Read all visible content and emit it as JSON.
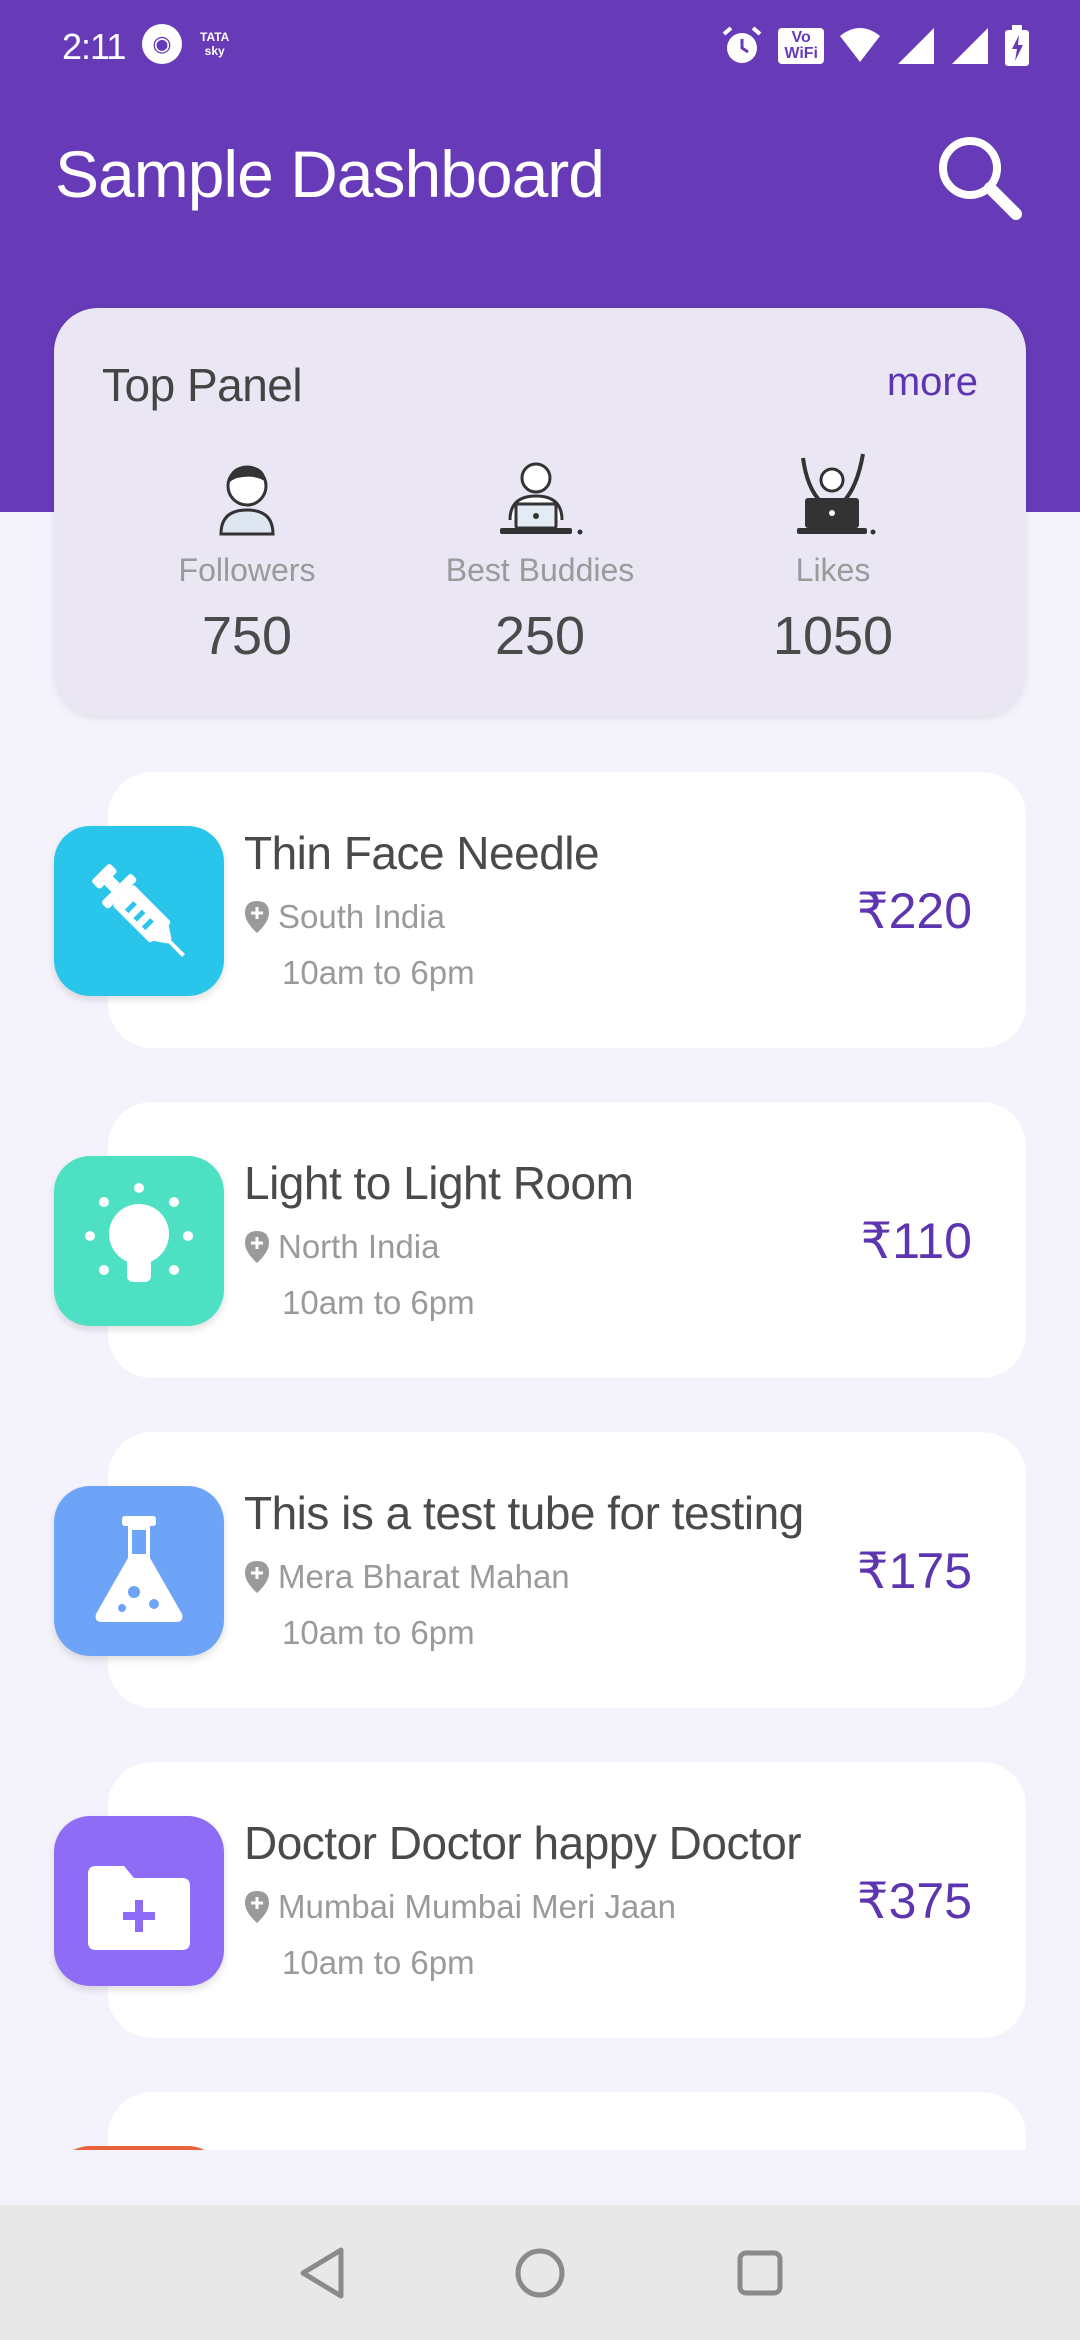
{
  "status_bar": {
    "time": "2:11",
    "left_icons": [
      "app-badge-icon",
      "tata-sky-icon"
    ],
    "tatasky_line1": "TATA",
    "tatasky_line2": "sky",
    "vowifi_line1": "Vo",
    "vowifi_line2": "WiFi",
    "right_icons": [
      "alarm-icon",
      "vowifi-icon",
      "wifi-icon",
      "signal-icon",
      "signal-icon",
      "battery-charging-icon"
    ]
  },
  "header": {
    "title": "Sample Dashboard",
    "search_icon": "search-icon"
  },
  "top_panel": {
    "title": "Top Panel",
    "more_label": "more",
    "stats": [
      {
        "icon": "person-icon",
        "label": "Followers",
        "value": "750"
      },
      {
        "icon": "laptop-user-icon",
        "label": "Best Buddies",
        "value": "250"
      },
      {
        "icon": "cheering-laptop-icon",
        "label": "Likes",
        "value": "1050"
      }
    ]
  },
  "items": [
    {
      "title": "Thin Face Needle",
      "location": "South India",
      "time": "10am to 6pm",
      "price": "₹220",
      "icon": "syringe-icon",
      "icon_color": "#29c5ea"
    },
    {
      "title": "Light to Light Room",
      "location": "North India",
      "time": "10am to 6pm",
      "price": "₹110",
      "icon": "lightbulb-icon",
      "icon_color": "#4de0c2"
    },
    {
      "title": "This is a test tube for testing",
      "location": "Mera Bharat Mahan",
      "time": "10am to 6pm",
      "price": "₹175",
      "icon": "flask-icon",
      "icon_color": "#6ea4f8"
    },
    {
      "title": "Doctor Doctor happy Doctor",
      "location": "Mumbai Mumbai Meri Jaan",
      "time": "10am to 6pm",
      "price": "₹375",
      "icon": "medical-folder-icon",
      "icon_color": "#8e6cf5"
    }
  ],
  "nav_bar": {
    "buttons": [
      "back-icon",
      "home-icon",
      "recents-icon"
    ]
  },
  "colors": {
    "primary": "#673ab7",
    "accent": "#5e35b1",
    "panel_bg": "#ebe6f3",
    "page_bg": "#f4f3fb"
  }
}
